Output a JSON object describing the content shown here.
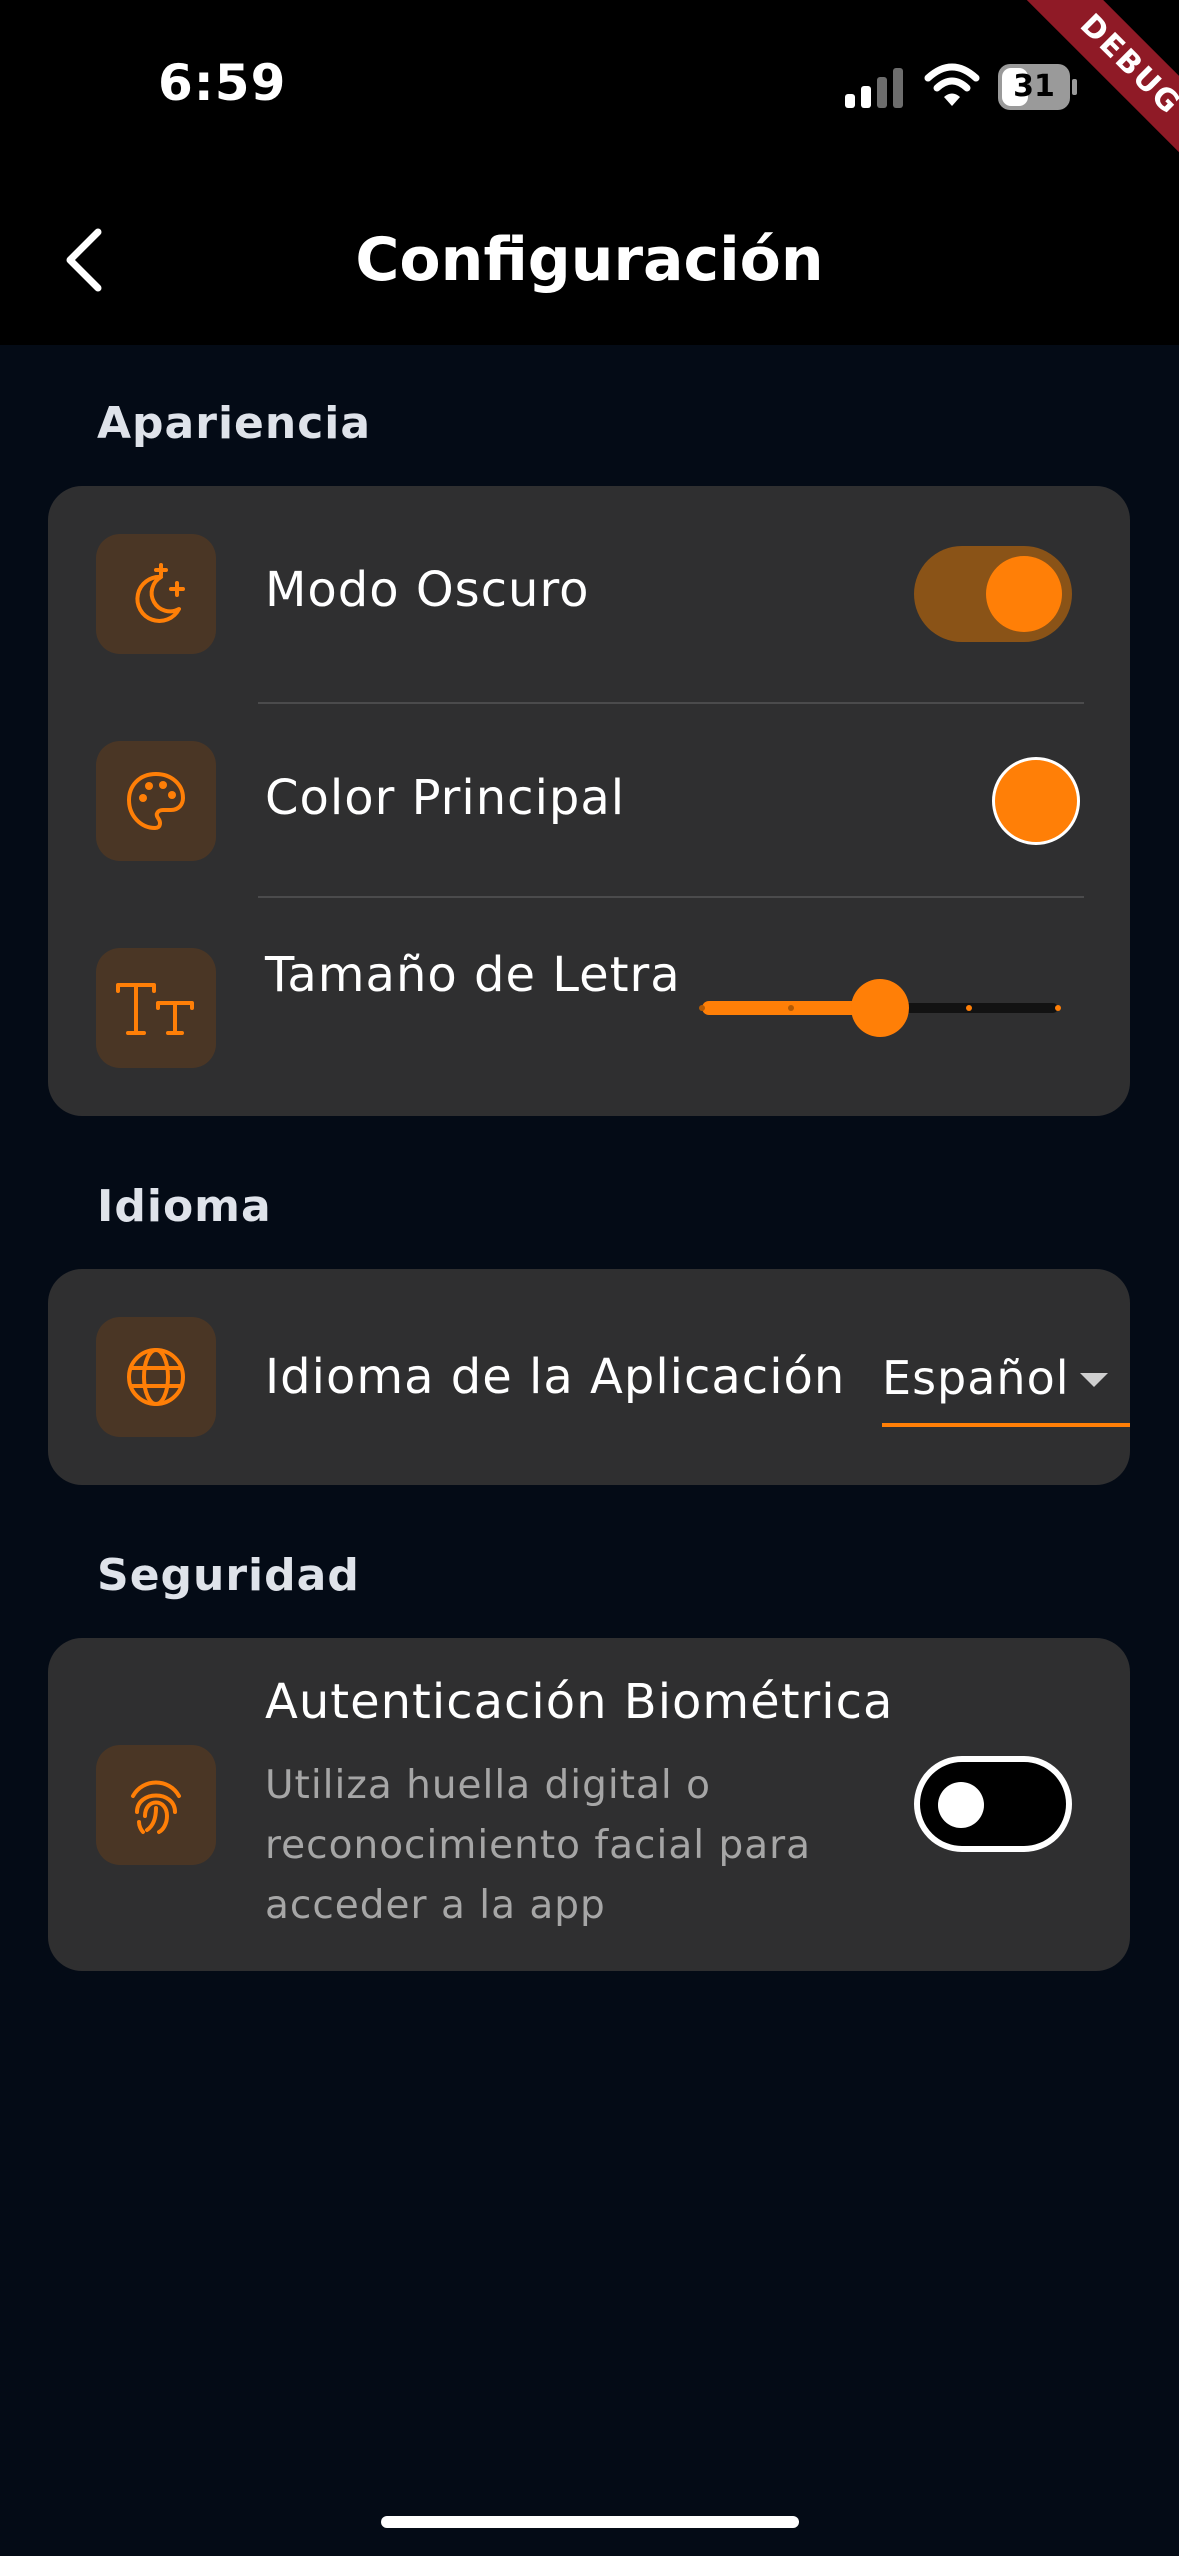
{
  "status_bar": {
    "time": "6:59",
    "battery": "31",
    "debug_label": "DEBUG"
  },
  "header": {
    "title": "Configuración"
  },
  "sections": {
    "appearance": {
      "title": "Apariencia",
      "dark_mode": {
        "label": "Modo Oscuro",
        "enabled": true
      },
      "primary_color": {
        "label": "Color Principal",
        "color": "#ff7f07"
      },
      "font_size": {
        "label": "Tamaño de Letra",
        "value_fraction": 0.5,
        "steps": 5
      }
    },
    "language": {
      "title": "Idioma",
      "app_language": {
        "label": "Idioma de la Aplicación",
        "value": "Español"
      }
    },
    "security": {
      "title": "Seguridad",
      "biometric": {
        "label": "Autenticación Biométrica",
        "description": "Utiliza huella digital o reconocimiento facial para acceder a la app",
        "enabled": false
      }
    }
  },
  "colors": {
    "accent": "#ff7f07",
    "background": "#040b16",
    "card": "#2f2f30",
    "icon_bg": "#4a3625"
  }
}
